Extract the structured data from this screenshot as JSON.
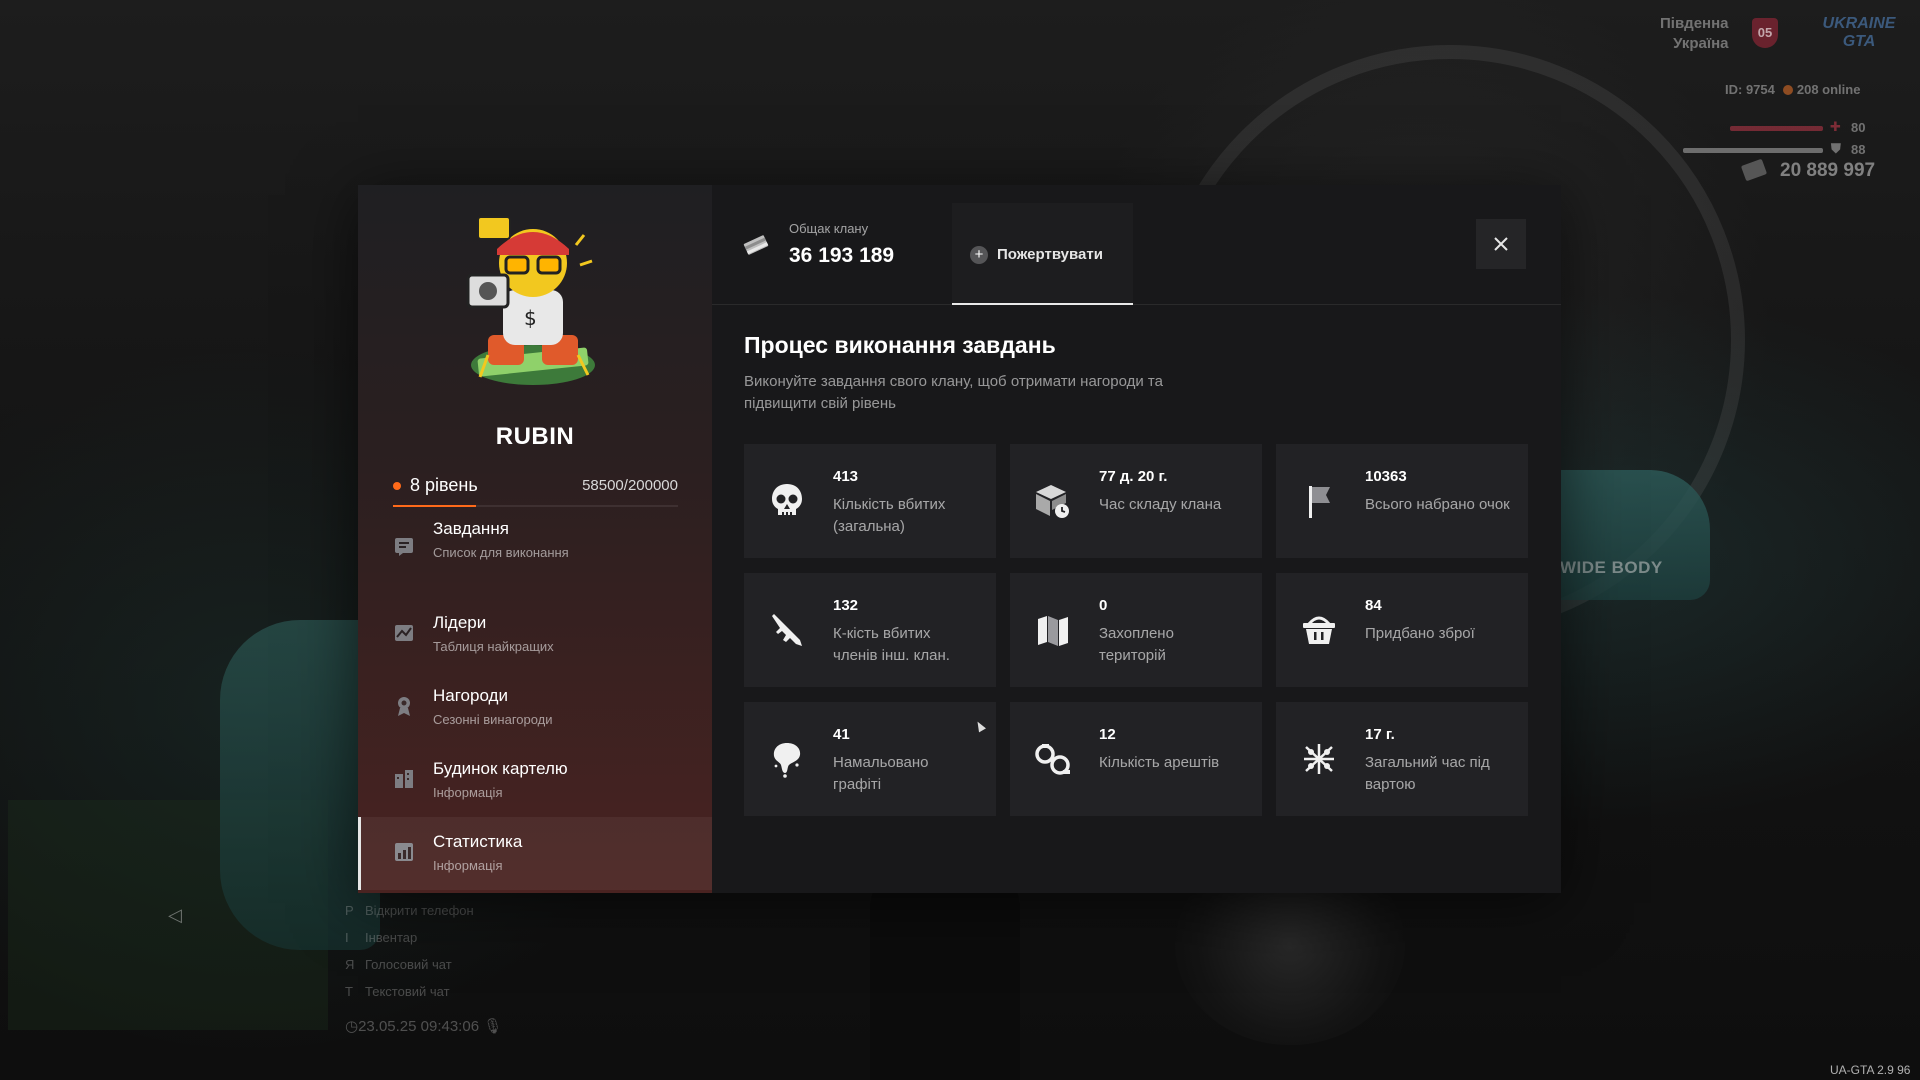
{
  "hud": {
    "region_line1": "Південна",
    "region_line2": "Україна",
    "region_badge": "05",
    "logo_line1": "UKRAINE",
    "logo_line2": "GTA",
    "player_id": "ID: 9754",
    "online": "208 online",
    "health": "80",
    "armor": "88",
    "money": "20 889 997",
    "health_color": "#c0394a",
    "armor_color": "#d0d0d0"
  },
  "key_hints": [
    {
      "key": "P",
      "label": "Відкрити телефон"
    },
    {
      "key": "I",
      "label": "Інвентар"
    },
    {
      "key": "Я",
      "label": "Голосовий чат"
    },
    {
      "key": "T",
      "label": "Текстовий чат"
    }
  ],
  "datetime": "23.05.25 09:43:06",
  "version": "UA-GTA 2.9 96",
  "background_text": "WIDE BODY",
  "sidebar": {
    "clan_name": "RUBIN",
    "level_label": "8 рівень",
    "xp_text": "58500/200000",
    "xp_progress": 0.29,
    "accent_color": "#ff6a1a",
    "items": [
      {
        "title": "Завдання",
        "subtitle": "Список для виконання",
        "icon": "tasks-icon"
      },
      {
        "title": "Лідери",
        "subtitle": "Таблиця найкращих",
        "icon": "chart-icon"
      },
      {
        "title": "Нагороди",
        "subtitle": "Сезонні винагороди",
        "icon": "award-icon"
      },
      {
        "title": "Будинок картелю",
        "subtitle": "Інформація",
        "icon": "building-icon"
      },
      {
        "title": "Статистика",
        "subtitle": "Інформація",
        "icon": "stats-icon"
      }
    ],
    "active_item": "Статистика"
  },
  "header": {
    "treasury_label": "Общак клану",
    "treasury_value": "36 193 189",
    "donate_label": "Пожертвувати"
  },
  "main": {
    "title": "Процес виконання завдань",
    "description": "Виконуйте завдання свого клану, щоб отримати нагороди та підвищити свій рівень",
    "stats": [
      {
        "value": "413",
        "label": "Кількість вбитих (загальна)",
        "icon": "skull-icon"
      },
      {
        "value": "77 д. 20 г.",
        "label": "Час складу клана",
        "icon": "box-clock-icon"
      },
      {
        "value": "10363",
        "label": "Всього набрано очок",
        "icon": "flag-icon"
      },
      {
        "value": "132",
        "label": "К-кість вбитих членів інш. клан.",
        "icon": "rifle-icon"
      },
      {
        "value": "0",
        "label": "Захоплено територій",
        "icon": "map-icon"
      },
      {
        "value": "84",
        "label": "Придбано зброї",
        "icon": "basket-icon"
      },
      {
        "value": "41",
        "label": "Намальовано графіті",
        "icon": "spray-icon"
      },
      {
        "value": "12",
        "label": "Кількість арештів",
        "icon": "handcuffs-icon"
      },
      {
        "value": "17 г.",
        "label": "Загальний час під вартою",
        "icon": "prison-icon"
      }
    ]
  }
}
